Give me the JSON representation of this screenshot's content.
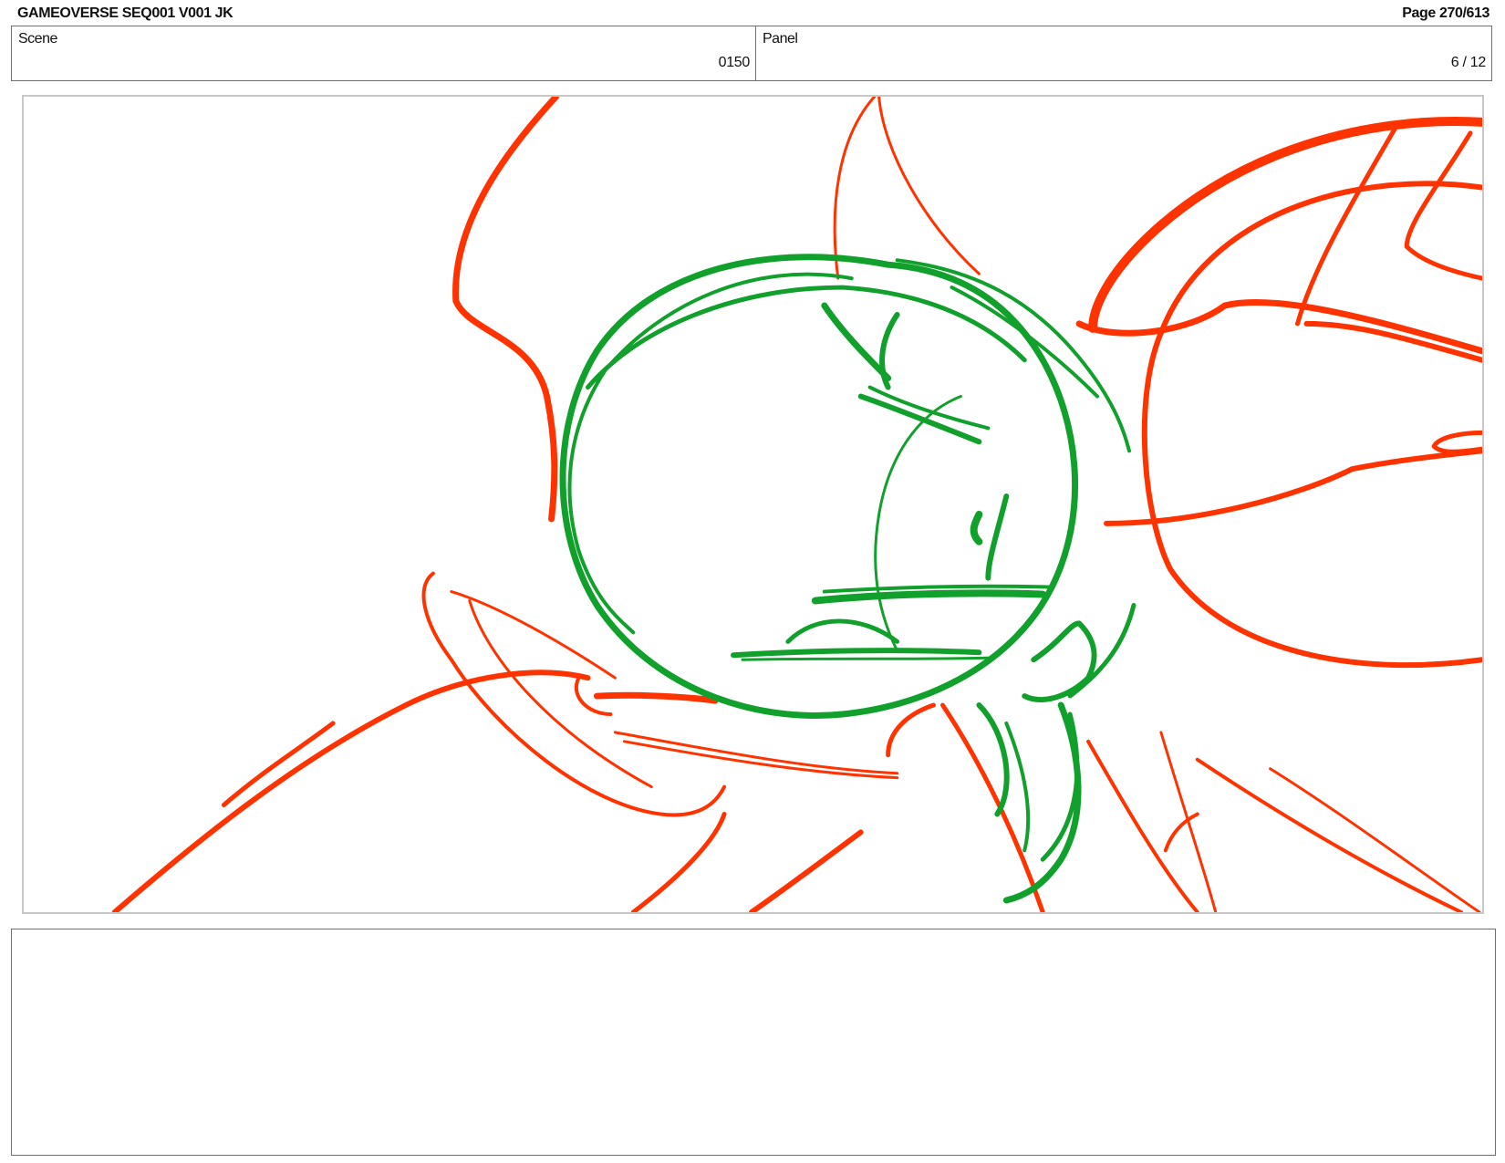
{
  "header": {
    "title": "GAMEOVERSE SEQ001 V001 JK",
    "page": "Page 270/613"
  },
  "scene": {
    "label": "Scene",
    "value": "0150"
  },
  "panel": {
    "label": "Panel",
    "value": "6 / 12"
  },
  "colors": {
    "sketch_red": "#ff3300",
    "sketch_green": "#12a02c"
  },
  "notes": {
    "text": ""
  }
}
